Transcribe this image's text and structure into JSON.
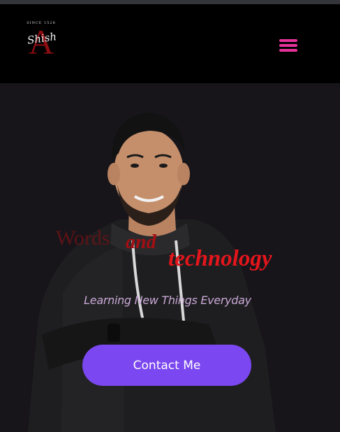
{
  "header": {
    "logo": {
      "since_text": "SINCE 1528",
      "letter": "A",
      "script_text": "Shish"
    },
    "menu_icon": "hamburger-menu-icon"
  },
  "hero": {
    "headline": {
      "word_1": "Words",
      "word_2": "and",
      "word_3": "technology"
    },
    "tagline": "Learning New Things Everyday",
    "cta_label": "Contact Me"
  },
  "colors": {
    "header_bg": "#000000",
    "hero_bg": "#17151a",
    "menu_accent": "#e8329a",
    "cta_bg": "#7b47f0",
    "headline_red": "#e4151b",
    "tagline": "#c9a8d6"
  }
}
